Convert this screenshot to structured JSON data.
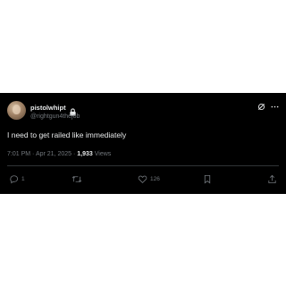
{
  "author": {
    "display_name": "pistolwhipt",
    "handle": "@rightgun4thejob",
    "locked": true
  },
  "tweet": {
    "text": "I need to get railed like immediately",
    "time": "7:01 PM",
    "separator": "·",
    "date": "Apr 21, 2025",
    "views_count": "1,933",
    "views_label": "Views"
  },
  "actions": {
    "reply_count": "1",
    "retweet_count": "",
    "like_count": "126"
  },
  "colors": {
    "background": "#000000",
    "text": "#e7e9ea",
    "secondary": "#71767b",
    "divider": "#2f3336"
  }
}
